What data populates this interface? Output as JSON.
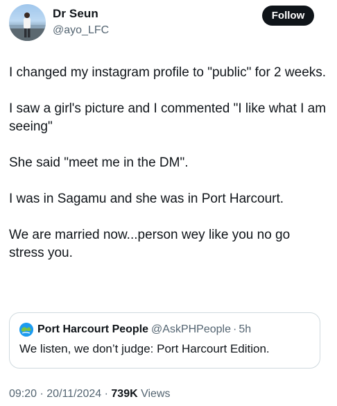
{
  "author": {
    "name": "Dr Seun",
    "handle": "@ayo_LFC",
    "follow_label": "Follow"
  },
  "tweet": {
    "paragraphs": [
      "I changed my instagram profile to \"public\" for 2 weeks.",
      "I saw a girl's picture and I commented \"I like what I am seeing\"",
      "She said \"meet me in the DM\".",
      "I was in Sagamu and she was in Port Harcourt.",
      "We are married now...person wey like you no go stress you."
    ]
  },
  "quoted_tweet": {
    "name": "Port Harcourt People",
    "handle": "@AskPHPeople",
    "separator": "·",
    "time": "5h",
    "text": "We listen, we don’t judge: Port Harcourt Edition."
  },
  "meta": {
    "time": "09:20",
    "date": "20/11/2024",
    "separator": "·",
    "views_count": "739K",
    "views_label": "Views"
  },
  "colors": {
    "text_primary": "#0f1419",
    "text_secondary": "#536471",
    "border": "#cfd9de",
    "button_bg": "#0f1419",
    "quote_avatar": "#1d9bf0"
  },
  "icons": {
    "author_avatar": "profile-photo",
    "quoted_avatar": "globe-avatar"
  }
}
